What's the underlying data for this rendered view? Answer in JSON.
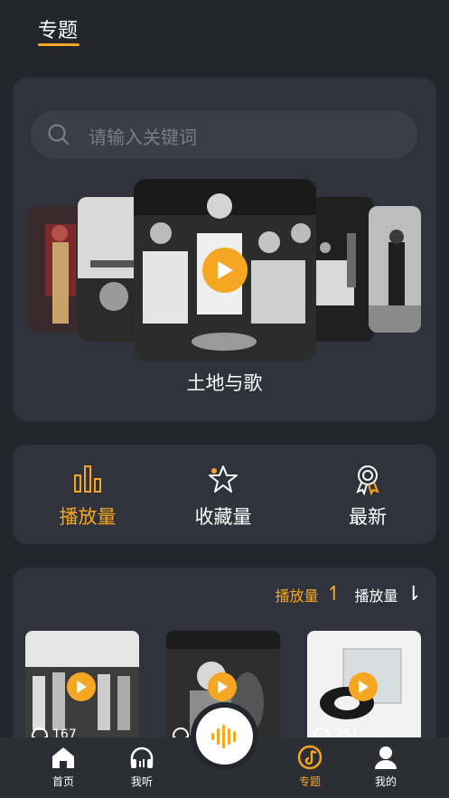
{
  "header": {
    "title": "专题"
  },
  "search": {
    "placeholder": "请输入关键词"
  },
  "carousel": {
    "featured_title": "土地与歌"
  },
  "stats": [
    {
      "label": "播放量",
      "active": true
    },
    {
      "label": "收藏量",
      "active": false
    },
    {
      "label": "最新",
      "active": false
    }
  ],
  "sort": {
    "asc_label": "播放量",
    "desc_label": "播放量"
  },
  "grid": [
    {
      "count": "167"
    },
    {
      "count": ""
    },
    {
      "count": "251"
    }
  ],
  "tabbar": {
    "home": "首页",
    "listen": "我听",
    "topics": "专题",
    "mine": "我的"
  },
  "colors": {
    "accent": "#f5a623",
    "background": "#23262d",
    "card": "#30333b"
  }
}
